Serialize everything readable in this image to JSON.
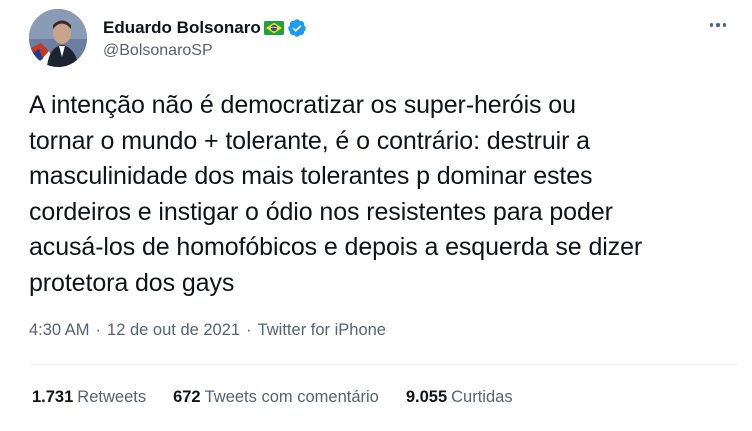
{
  "author": {
    "display_name": "Eduardo Bolsonaro",
    "handle": "@BolsonaroSP",
    "flag_icon": "brazil-flag-icon",
    "verified_icon": "verified-badge-icon",
    "verified_color": "#1d9bf0"
  },
  "tweet": {
    "lines": [
      "A intenção não é democratizar os super-heróis ou",
      "tornar o mundo + tolerante, é o contrário: destruir a",
      "masculinidade dos mais tolerantes p dominar estes",
      "cordeiros e instigar o ódio nos resistentes para poder",
      "acusá-los de homofóbicos e depois a esquerda se dizer",
      "protetora dos gays"
    ]
  },
  "meta": {
    "time": "4:30 AM",
    "separator": "·",
    "date": "12 de out de 2021",
    "source": "Twitter for iPhone"
  },
  "stats": {
    "retweets_count": "1.731",
    "retweets_label": "Retweets",
    "quotes_count": "672",
    "quotes_label": "Tweets com comentário",
    "likes_count": "9.055",
    "likes_label": "Curtidas"
  },
  "colors": {
    "text_primary": "#0f1419",
    "text_secondary": "#536471",
    "divider": "#eff3f4"
  }
}
